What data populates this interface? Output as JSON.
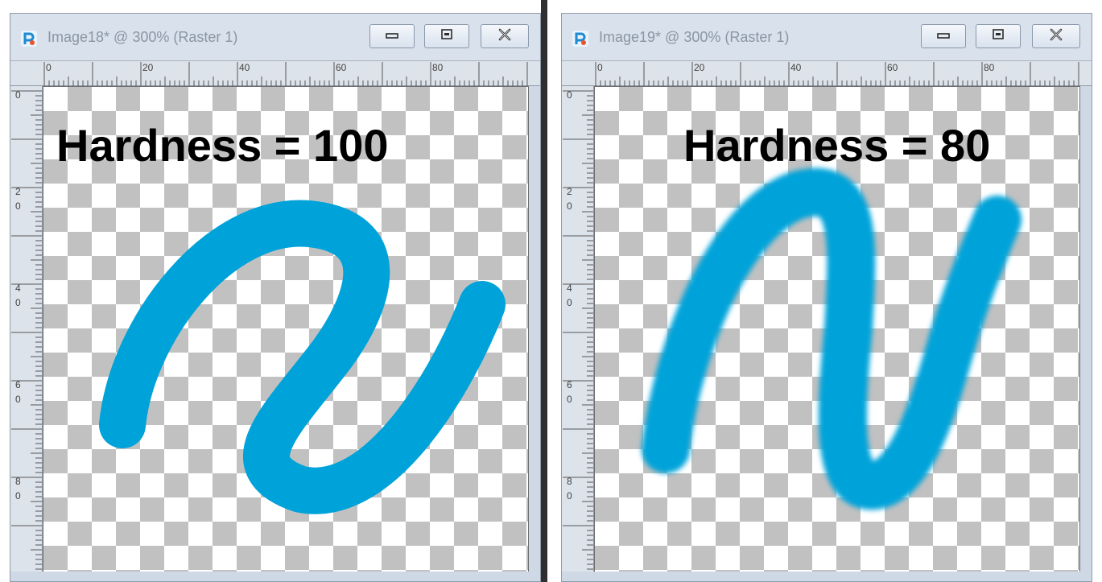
{
  "windows": [
    {
      "title": "Image18* @ 300% (Raster 1)",
      "canvas_label": "Hardness = 100",
      "brush": {
        "hardness": 100,
        "color": "#00a3d9"
      }
    },
    {
      "title": "Image19* @ 300% (Raster 1)",
      "canvas_label": "Hardness = 80",
      "brush": {
        "hardness": 80,
        "color": "#00a3d9"
      }
    }
  ],
  "ruler": {
    "top_labels": [
      "0",
      "20",
      "40",
      "60",
      "80"
    ],
    "left_labels": [
      [
        "0"
      ],
      [
        "2",
        "0"
      ],
      [
        "4",
        "0"
      ],
      [
        "6",
        "0"
      ],
      [
        "8",
        "0"
      ]
    ]
  },
  "icons": {
    "app": "paintshop-pro-icon",
    "minimize": "minimize-icon",
    "maximize": "restore-icon",
    "close": "close-icon"
  }
}
